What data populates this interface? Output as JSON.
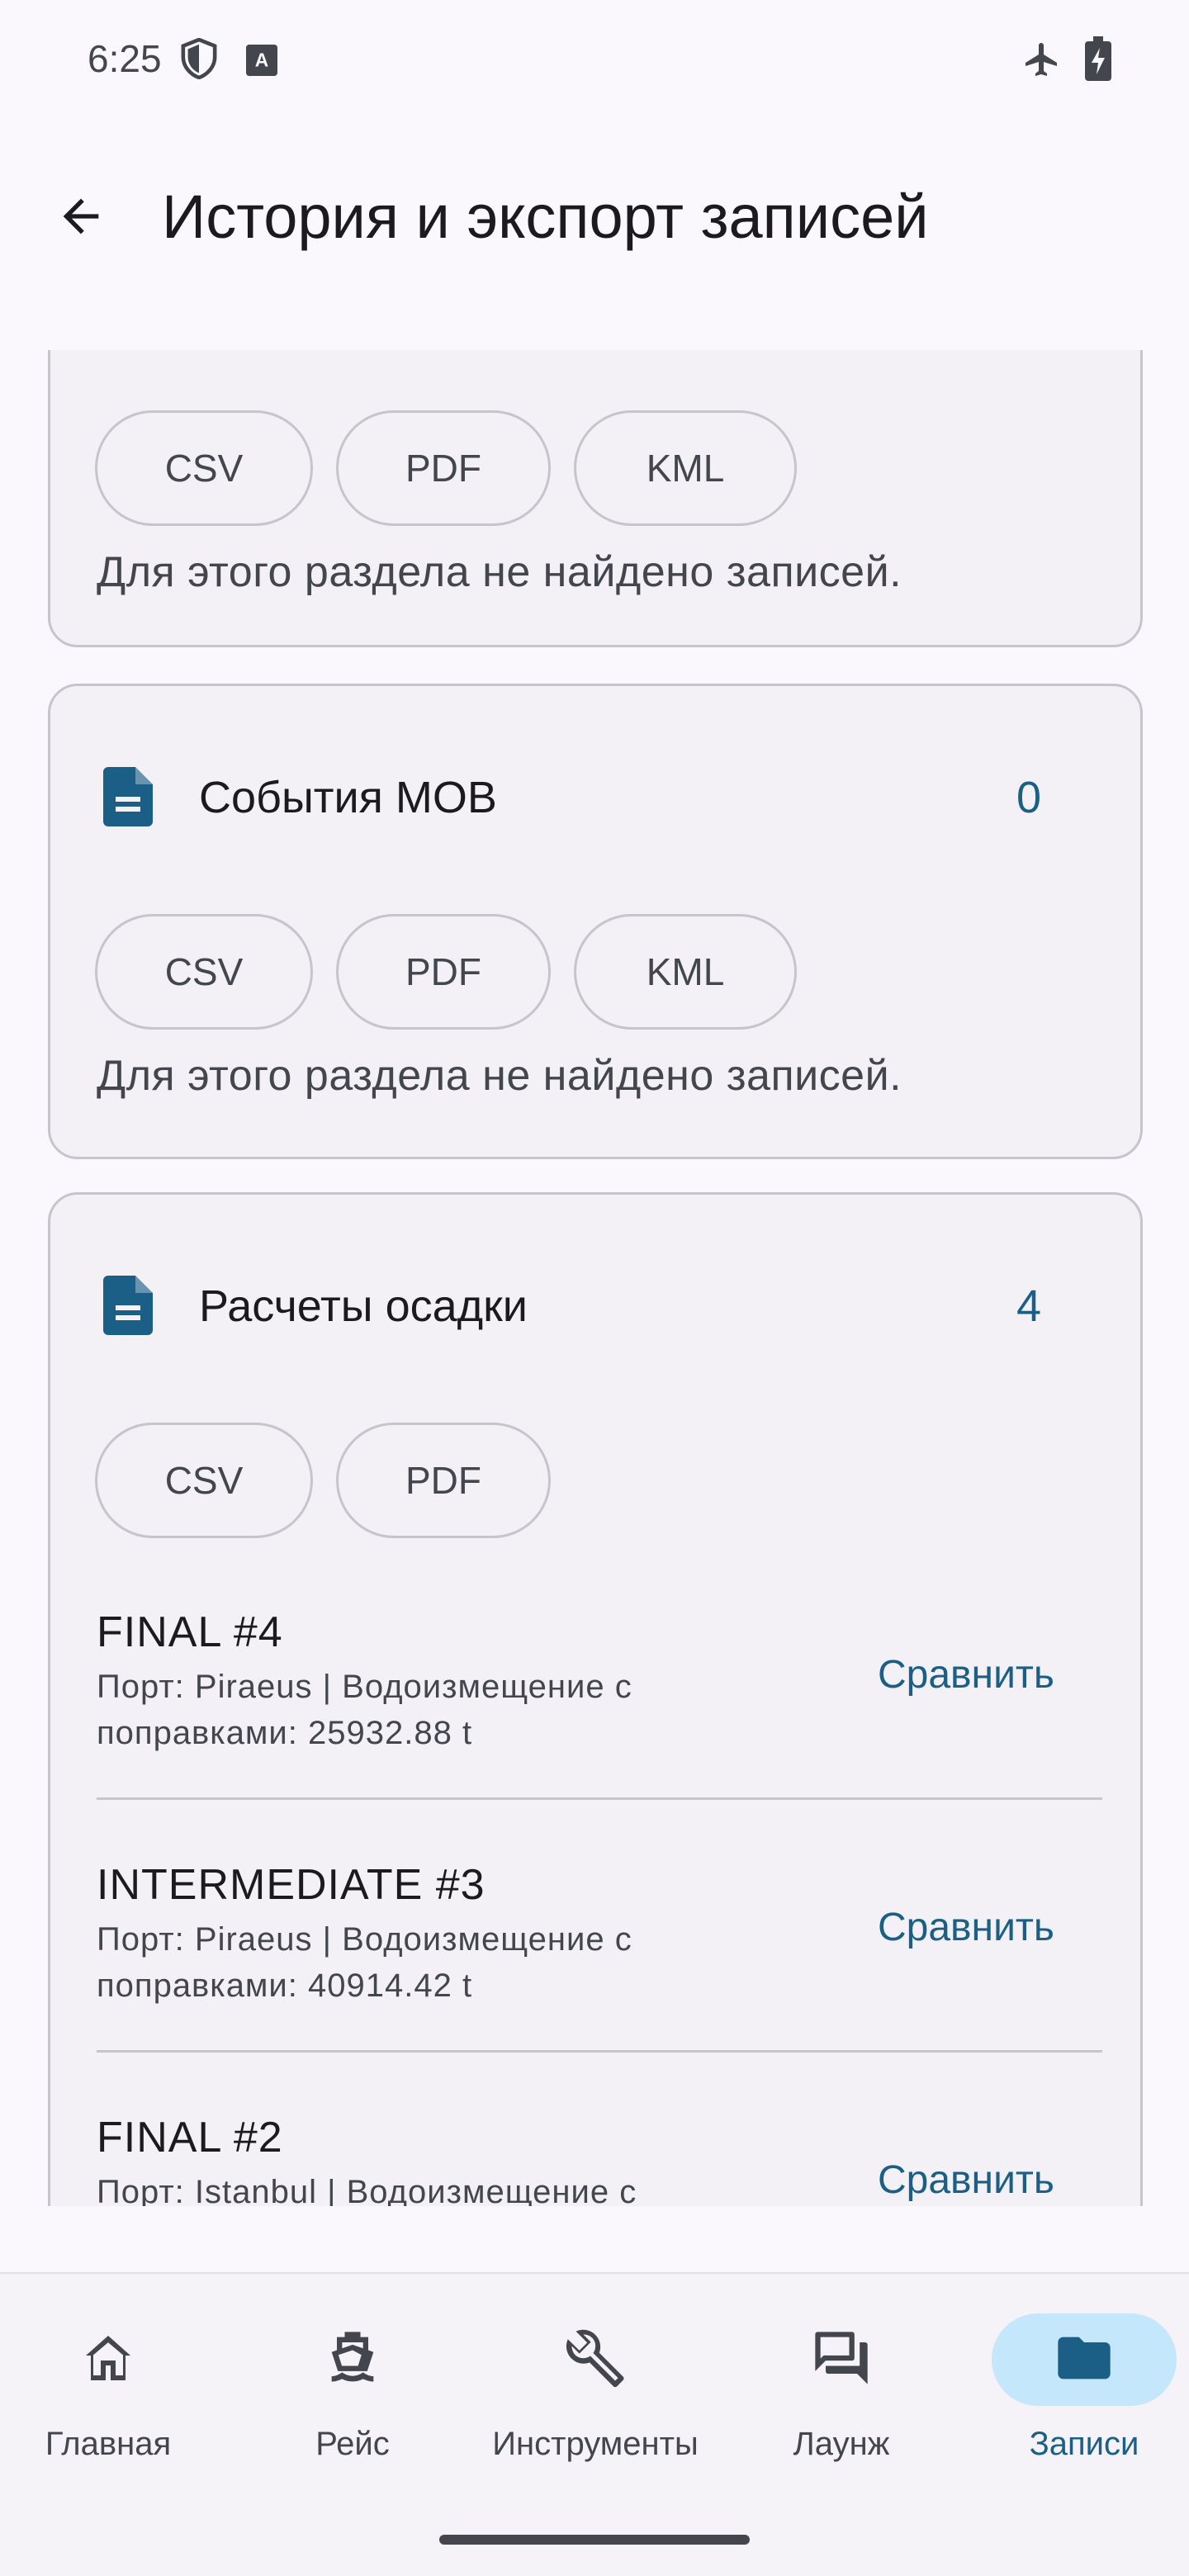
{
  "status_bar": {
    "time": "6:25",
    "icons": [
      "shield-icon",
      "keyboard-a-icon",
      "airplane-icon",
      "battery-charging-icon"
    ]
  },
  "app_bar": {
    "title": "История и экспорт записей",
    "back_icon": "arrow-back-icon"
  },
  "sections": [
    {
      "chips": [
        "CSV",
        "PDF",
        "KML"
      ],
      "empty_text": "Для этого раздела не найдено записей."
    },
    {
      "icon": "document-icon",
      "title": "События МОВ",
      "count": "0",
      "chips": [
        "CSV",
        "PDF",
        "KML"
      ],
      "empty_text": "Для этого раздела не найдено записей."
    },
    {
      "icon": "document-icon",
      "title": "Расчеты осадки",
      "count": "4",
      "chips": [
        "CSV",
        "PDF"
      ],
      "records": [
        {
          "title": "FINAL #4",
          "subtitle": "Порт: Piraeus | Водоизмещение с поправками: 25932.88 t",
          "action": "Сравнить"
        },
        {
          "title": "INTERMEDIATE #3",
          "subtitle": "Порт: Piraeus | Водоизмещение с поправками: 40914.42 t",
          "action": "Сравнить"
        },
        {
          "title": "FINAL #2",
          "subtitle": "Порт: Istanbul | Водоизмещение с",
          "action": "Сравнить"
        }
      ]
    }
  ],
  "bottom_nav": [
    {
      "label": "Главная",
      "icon": "home-icon",
      "active": false
    },
    {
      "label": "Рейс",
      "icon": "ship-icon",
      "active": false
    },
    {
      "label": "Инструменты",
      "icon": "wrench-icon",
      "active": false
    },
    {
      "label": "Лаунж",
      "icon": "forum-icon",
      "active": false
    },
    {
      "label": "Записи",
      "icon": "folder-icon",
      "active": true
    }
  ],
  "colors": {
    "accent": "#1b5f86",
    "active_indicator": "#c5e7fb",
    "card_bg": "#f3f1f6",
    "outline": "#c6c5cc"
  }
}
